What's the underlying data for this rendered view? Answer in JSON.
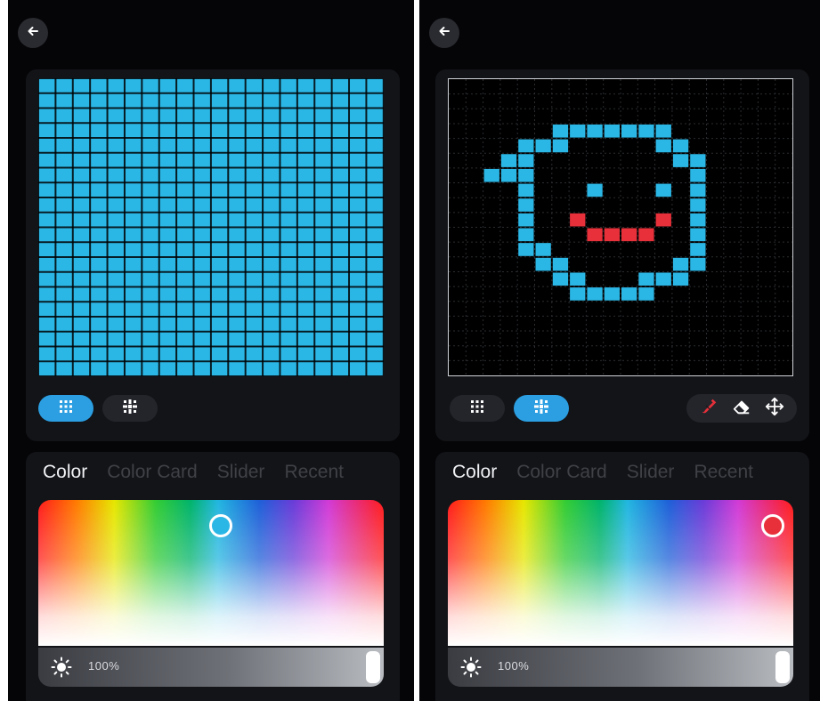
{
  "colors": {
    "panel_bg": "#050507",
    "card_bg": "#131418",
    "accent_blue": "#2b9fe2",
    "pixel_cyan": "#2bb7e6",
    "pixel_red": "#e8303a"
  },
  "left_panel": {
    "back_icon": "arrow-left-icon",
    "mode_buttons": [
      {
        "icon": "grid-dots-icon",
        "active": true
      },
      {
        "icon": "grid-dots-alt-icon",
        "active": false
      }
    ],
    "color_tabs": [
      {
        "label": "Color",
        "active": true
      },
      {
        "label": "Color Card",
        "active": false
      },
      {
        "label": "Slider",
        "active": false
      },
      {
        "label": "Recent",
        "active": false
      }
    ],
    "selected_color": "#2bb7e6",
    "brightness_label": "100%",
    "brightness_value": 1.0
  },
  "right_panel": {
    "back_icon": "arrow-left-icon",
    "mode_buttons": [
      {
        "icon": "grid-dots-icon",
        "active": false
      },
      {
        "icon": "grid-dots-alt-icon",
        "active": true
      }
    ],
    "tools": [
      "paint-brush-icon",
      "eraser-icon",
      "move-icon"
    ],
    "color_tabs": [
      {
        "label": "Color",
        "active": true
      },
      {
        "label": "Color Card",
        "active": false
      },
      {
        "label": "Slider",
        "active": false
      },
      {
        "label": "Recent",
        "active": false
      }
    ],
    "selected_color": "#e8303a",
    "brightness_label": "100%",
    "brightness_value": 1.0,
    "pixel_art": {
      "grid_size": 20,
      "cyan_cells": [
        [
          6,
          3
        ],
        [
          7,
          3
        ],
        [
          8,
          3
        ],
        [
          9,
          3
        ],
        [
          10,
          3
        ],
        [
          11,
          3
        ],
        [
          12,
          3
        ],
        [
          6,
          4
        ],
        [
          12,
          4
        ],
        [
          13,
          4
        ],
        [
          5,
          4
        ],
        [
          4,
          4
        ],
        [
          13,
          5
        ],
        [
          14,
          5
        ],
        [
          14,
          6
        ],
        [
          14,
          7
        ],
        [
          14,
          8
        ],
        [
          14,
          9
        ],
        [
          14,
          10
        ],
        [
          14,
          11
        ],
        [
          14,
          12
        ],
        [
          13,
          12
        ],
        [
          13,
          13
        ],
        [
          12,
          13
        ],
        [
          11,
          13
        ],
        [
          11,
          14
        ],
        [
          10,
          14
        ],
        [
          9,
          14
        ],
        [
          8,
          14
        ],
        [
          7,
          14
        ],
        [
          7,
          13
        ],
        [
          6,
          13
        ],
        [
          6,
          12
        ],
        [
          5,
          12
        ],
        [
          5,
          11
        ],
        [
          4,
          11
        ],
        [
          4,
          10
        ],
        [
          4,
          9
        ],
        [
          4,
          8
        ],
        [
          4,
          7
        ],
        [
          4,
          6
        ],
        [
          3,
          6
        ],
        [
          2,
          6
        ],
        [
          3,
          5
        ],
        [
          4,
          5
        ],
        [
          8,
          7
        ],
        [
          12,
          7
        ]
      ],
      "red_cells": [
        [
          7,
          9
        ],
        [
          12,
          9
        ],
        [
          8,
          10
        ],
        [
          9,
          10
        ],
        [
          10,
          10
        ],
        [
          11,
          10
        ]
      ]
    }
  }
}
